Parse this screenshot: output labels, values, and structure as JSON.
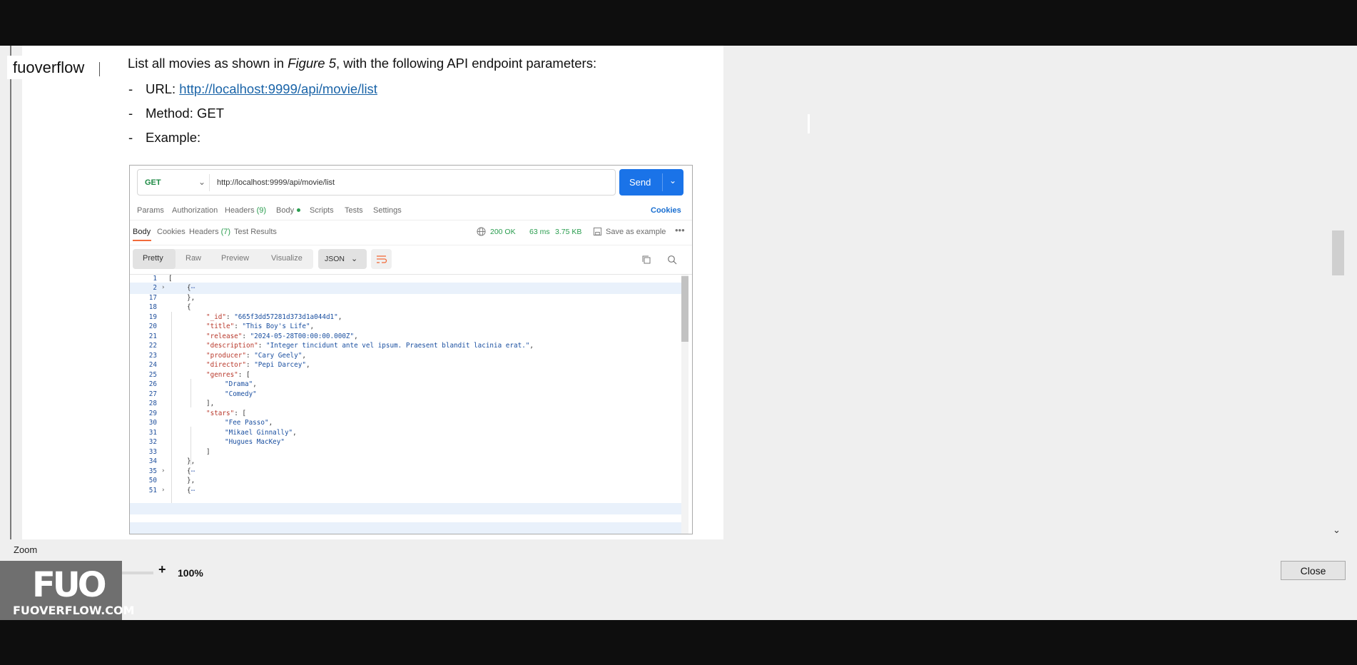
{
  "watermark": "fuoverflow",
  "document": {
    "intro_before": "List all movies as shown in ",
    "intro_italic": "Figure 5",
    "intro_after": ", with the following API endpoint parameters:",
    "bullets": [
      {
        "dash": "-",
        "label": "URL: ",
        "link": "http://localhost:9999/api/movie/list"
      },
      {
        "dash": "-",
        "label": "Method: GET"
      },
      {
        "dash": "-",
        "label": "Example:"
      }
    ]
  },
  "postman": {
    "method": "GET",
    "url": "http://localhost:9999/api/movie/list",
    "send_label": "Send",
    "request_tabs": {
      "params": "Params",
      "authorization": "Authorization",
      "headers": "Headers",
      "headers_count": "(9)",
      "body": "Body",
      "scripts": "Scripts",
      "tests": "Tests",
      "settings": "Settings",
      "cookies": "Cookies"
    },
    "response_tabs": {
      "body": "Body",
      "cookies": "Cookies",
      "headers": "Headers",
      "headers_count": "(7)",
      "test_results": "Test Results"
    },
    "status": {
      "code": "200 OK",
      "time": "63 ms",
      "size": "3.75 KB"
    },
    "save_as_example": "Save as example",
    "more": "•••",
    "view_tabs": [
      "Pretty",
      "Raw",
      "Preview",
      "Visualize"
    ],
    "format": "JSON",
    "code": {
      "ln1": "1",
      "l1": "[",
      "ln2": "2",
      "l2": "{",
      "ln17": "17",
      "l17": "},",
      "ln18": "18",
      "l18": "{",
      "ln19": "19",
      "k19": "\"_id\"",
      "v19": "\"665f3dd57281d373d1a044d1\"",
      "ln20": "20",
      "k20": "\"title\"",
      "v20": "\"This Boy's Life\"",
      "ln21": "21",
      "k21": "\"release\"",
      "v21": "\"2024-05-28T00:00:00.000Z\"",
      "ln22": "22",
      "k22": "\"description\"",
      "v22": "\"Integer tincidunt ante vel ipsum. Praesent blandit lacinia erat.\"",
      "ln23": "23",
      "k23": "\"producer\"",
      "v23": "\"Cary Geely\"",
      "ln24": "24",
      "k24": "\"director\"",
      "v24": "\"Pepi Darcey\"",
      "ln25": "25",
      "k25": "\"genres\"",
      "v25": "[",
      "ln26": "26",
      "v26": "\"Drama\"",
      "ln27": "27",
      "v27": "\"Comedy\"",
      "ln28": "28",
      "l28": "],",
      "ln29": "29",
      "k29": "\"stars\"",
      "v29": "[",
      "ln30": "30",
      "v30": "\"Fee Passo\"",
      "ln31": "31",
      "v31": "\"Mikael Ginnally\"",
      "ln32": "32",
      "v32": "\"Hugues MacKey\"",
      "ln33": "33",
      "l33": "]",
      "ln34": "34",
      "l34": "},",
      "ln35": "35",
      "l35": "{",
      "ln50": "50",
      "l50": "},",
      "ln51": "51",
      "l51": "{"
    }
  },
  "zoom": {
    "label": "Zoom",
    "minus": "-",
    "plus": "+",
    "value": "100%",
    "level_percent": 40
  },
  "close_label": "Close",
  "logo": {
    "mark": "FUO",
    "text": "FUOVERFLOW.COM"
  },
  "colors": {
    "send": "#1a73e8",
    "ok": "#2a9d4f",
    "link": "#1a64a8",
    "json_key": "#b8392c",
    "json_string": "#1a4fa0"
  }
}
